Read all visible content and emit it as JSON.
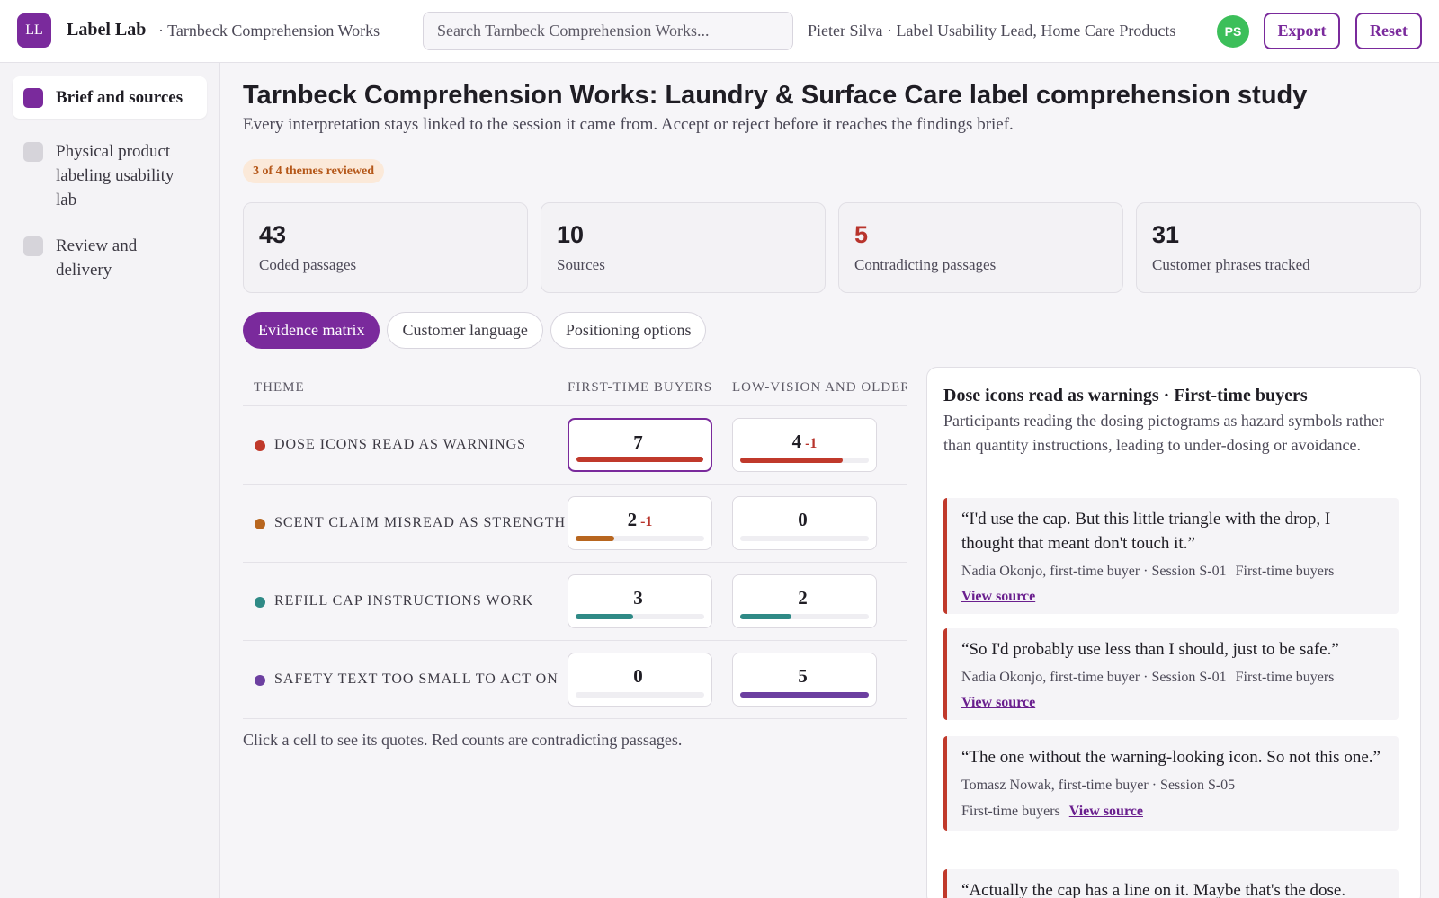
{
  "app": {
    "logo_initials": "LL",
    "name": "Label Lab",
    "breadcrumb": "· Tarnbeck Comprehension Works",
    "search_placeholder": "Search Tarnbeck Comprehension Works...",
    "user_text": "Pieter Silva · Label Usability Lead, Home Care Products",
    "avatar_initials": "PS",
    "export_label": "Export",
    "reset_label": "Reset"
  },
  "sidebar": {
    "items": [
      {
        "label": "Brief and sources",
        "active": true
      },
      {
        "label": "Physical product labeling usability lab",
        "active": false
      },
      {
        "label": "Review and delivery",
        "active": false
      }
    ]
  },
  "page": {
    "title": "Tarnbeck Comprehension Works: Laundry & Surface Care label comprehension study",
    "subtitle": "Every interpretation stays linked to the session it came from. Accept or reject before it reaches the findings brief.",
    "review_badge": "3 of 4 themes reviewed"
  },
  "stats": [
    {
      "value": "43",
      "label": "Coded passages"
    },
    {
      "value": "10",
      "label": "Sources"
    },
    {
      "value": "5",
      "label": "Contradicting passages",
      "warn": true
    },
    {
      "value": "31",
      "label": "Customer phrases tracked"
    }
  ],
  "tabs": [
    {
      "label": "Evidence matrix",
      "active": true
    },
    {
      "label": "Customer language",
      "active": false
    },
    {
      "label": "Positioning options",
      "active": false
    }
  ],
  "matrix": {
    "headers": [
      "THEME",
      "FIRST-TIME BUYERS",
      "LOW-VISION AND OLDER ADULTS"
    ],
    "rows": [
      {
        "theme": "DOSE ICONS READ AS WARNINGS",
        "color": "#c0392b",
        "cells": [
          {
            "count": "7",
            "contra": "",
            "level": 1.0,
            "selected": true
          },
          {
            "count": "4",
            "contra": "-1",
            "level": 0.8
          }
        ]
      },
      {
        "theme": "SCENT CLAIM MISREAD AS STRENGTH",
        "color": "#b8661f",
        "cells": [
          {
            "count": "2",
            "contra": "-1",
            "level": 0.3
          },
          {
            "count": "0",
            "contra": "",
            "level": 0
          }
        ]
      },
      {
        "theme": "REFILL CAP INSTRUCTIONS WORK",
        "color": "#2f8a86",
        "cells": [
          {
            "count": "3",
            "contra": "",
            "level": 0.45
          },
          {
            "count": "2",
            "contra": "",
            "level": 0.4
          }
        ]
      },
      {
        "theme": "SAFETY TEXT TOO SMALL TO ACT ON",
        "color": "#6c3fa0",
        "cells": [
          {
            "count": "0",
            "contra": "",
            "level": 0
          },
          {
            "count": "5",
            "contra": "",
            "level": 1.0
          }
        ]
      }
    ],
    "note": "Click a cell to see its quotes. Red counts are contradicting passages."
  },
  "detail": {
    "title": "Dose icons read as warnings · First-time buyers",
    "description": "Participants reading the dosing pictograms as hazard symbols rather than quantity instructions, leading to under-dosing or avoidance.",
    "quotes": [
      {
        "text": "“I'd use the cap. But this little triangle with the drop, I thought that meant don't touch it.”",
        "speaker": "Nadia Okonjo, first-time buyer · Session S-01",
        "segment": "First-time buyers",
        "link": "View source"
      },
      {
        "text": "“So I'd probably use less than I should, just to be safe.”",
        "speaker": "Nadia Okonjo, first-time buyer · Session S-01",
        "segment": "First-time buyers",
        "link": "View source"
      },
      {
        "text": "“The one without the warning-looking icon. So not this one.”",
        "speaker": "Tomasz Nowak, first-time buyer · Session S-05",
        "segment": "First-time buyers",
        "link": "View source"
      },
      {
        "text": "“Actually the cap has a line on it. Maybe that's the dose."
      }
    ]
  }
}
